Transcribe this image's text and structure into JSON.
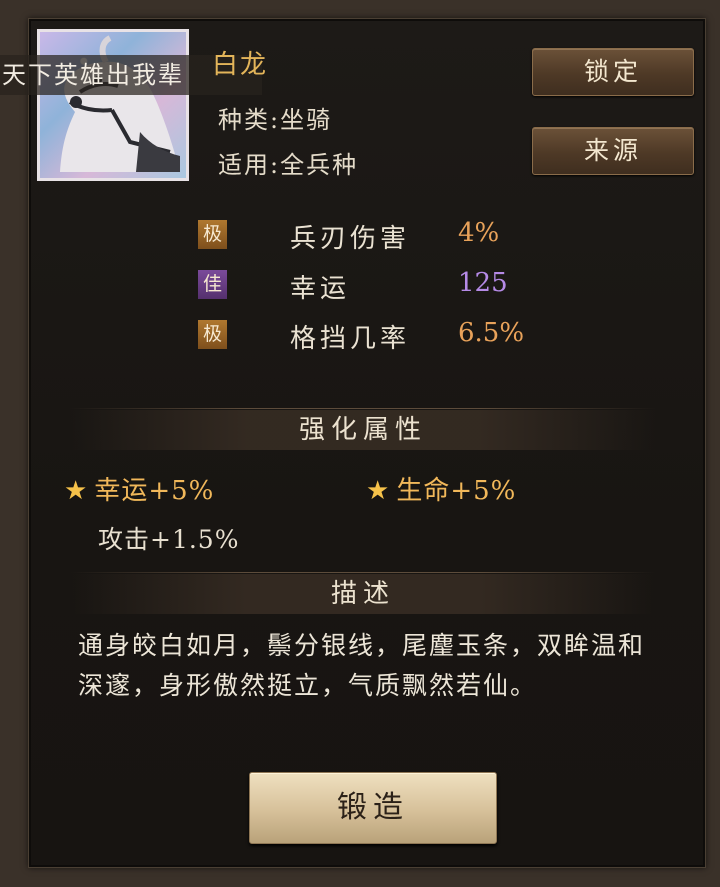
{
  "banner": {
    "scrolling_text": "天下英雄出我辈"
  },
  "item": {
    "name": "白龙",
    "type_line": "种类:坐骑",
    "usage_line": "适用:全兵种"
  },
  "buttons": {
    "lock": "锁定",
    "source": "来源",
    "forge": "锻造"
  },
  "attributes": [
    {
      "grade": "极",
      "grade_color": "#a86f2c",
      "label": "兵刃伤害",
      "value": "4%",
      "value_color": "#e8a25a"
    },
    {
      "grade": "佳",
      "grade_color": "#6c3f8a",
      "label": "幸运",
      "value": "125",
      "value_color": "#b58ae6"
    },
    {
      "grade": "极",
      "grade_color": "#a86f2c",
      "label": "格挡几率",
      "value": "6.5%",
      "value_color": "#e8a25a"
    }
  ],
  "enhance": {
    "title": "强化属性",
    "bonuses": [
      "幸运+5%",
      "生命+5%"
    ],
    "extra": "攻击+1.5%"
  },
  "description": {
    "title": "描述",
    "text": "通身皎白如月，鬃分银线，尾麈玉条，双眸温和深邃，身形傲然挺立，气质飘然若仙。"
  },
  "icons": {
    "portrait": "white-horse-portrait",
    "star": "star-icon"
  }
}
